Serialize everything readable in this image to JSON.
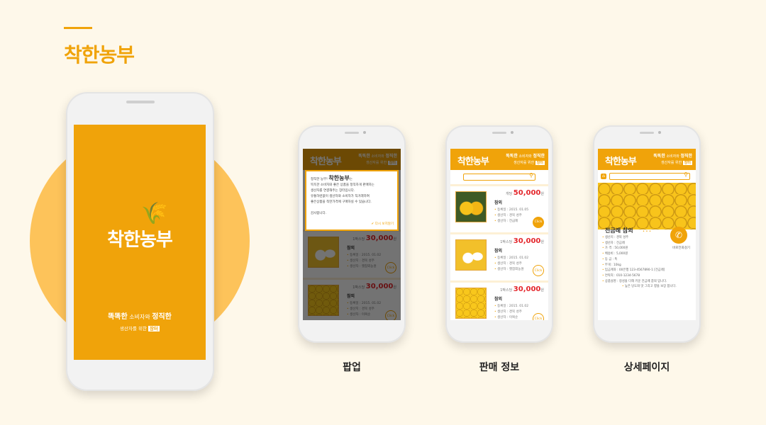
{
  "page": {
    "title": "착한농부",
    "labels": [
      "팝업",
      "판매 정보",
      "상세페이지"
    ]
  },
  "brand": {
    "logo": "착한농부",
    "slogan1a": "똑똑한",
    "slogan1b": "소비자와",
    "slogan1c": "정직한",
    "slogan2a": "생산자를 위한",
    "slogan2b": "장터"
  },
  "colors": {
    "accent": "#f0a30a",
    "price": "#e4262b"
  },
  "popup": {
    "lead": "정직한 농부!",
    "brand": "착한농부",
    "lead_end": "는",
    "body": [
      "똑똑한 소비자와 좋은 상품을 정직하게 판매하는",
      "생산자를 연결해주는 장터입니다.",
      "유통하련없이 생산자와 소비자가 직거래하여",
      "좋은상품을 착한가격에 구매하실 수 있습니다."
    ],
    "thanks": "감사합니다.",
    "dismiss": "다시 보지않기"
  },
  "items": [
    {
      "unit": "개당",
      "price": "50,000",
      "won": "원",
      "name": "참외",
      "lines": [
        "등록일 : 2015. 01.05",
        "생산지 : 경북 성주",
        "생산자 : 전금례"
      ],
      "click": "Click",
      "thumb": "green"
    },
    {
      "unit": "1박스당",
      "price": "30,000",
      "won": "원",
      "name": "참외",
      "lines": [
        "등록일 : 2015. 01.02",
        "생산지 : 경북 성주",
        "생산자 : 햇참외농원"
      ],
      "click": "Click",
      "thumb": "cut"
    },
    {
      "unit": "1박스당",
      "price": "30,000",
      "won": "원",
      "name": "참외",
      "lines": [
        "등록일 : 2015. 01.02",
        "생산지 : 경북 성주",
        "생산자 : 이복순"
      ],
      "click": "Click",
      "thumb": "box"
    }
  ],
  "detail": {
    "name": "전금례 참외",
    "lines": [
      "생산지 : 경북 성주",
      "생산자 : 전금례",
      "가    격 : 50,000원",
      "배송비 : 5,000원",
      "등    급 : 특",
      "무게 : 10kg",
      "입금계좌 : 00은행 123-4567890-1 [전금례]",
      "연락처 : 010-1234-5678",
      "상품설명 : 정성을 다해 키운 전금례 참외 입니다.",
      "높은 당도와 맛 그리고 향을 보장 합니다."
    ],
    "call_label": "바로전화걸기"
  }
}
